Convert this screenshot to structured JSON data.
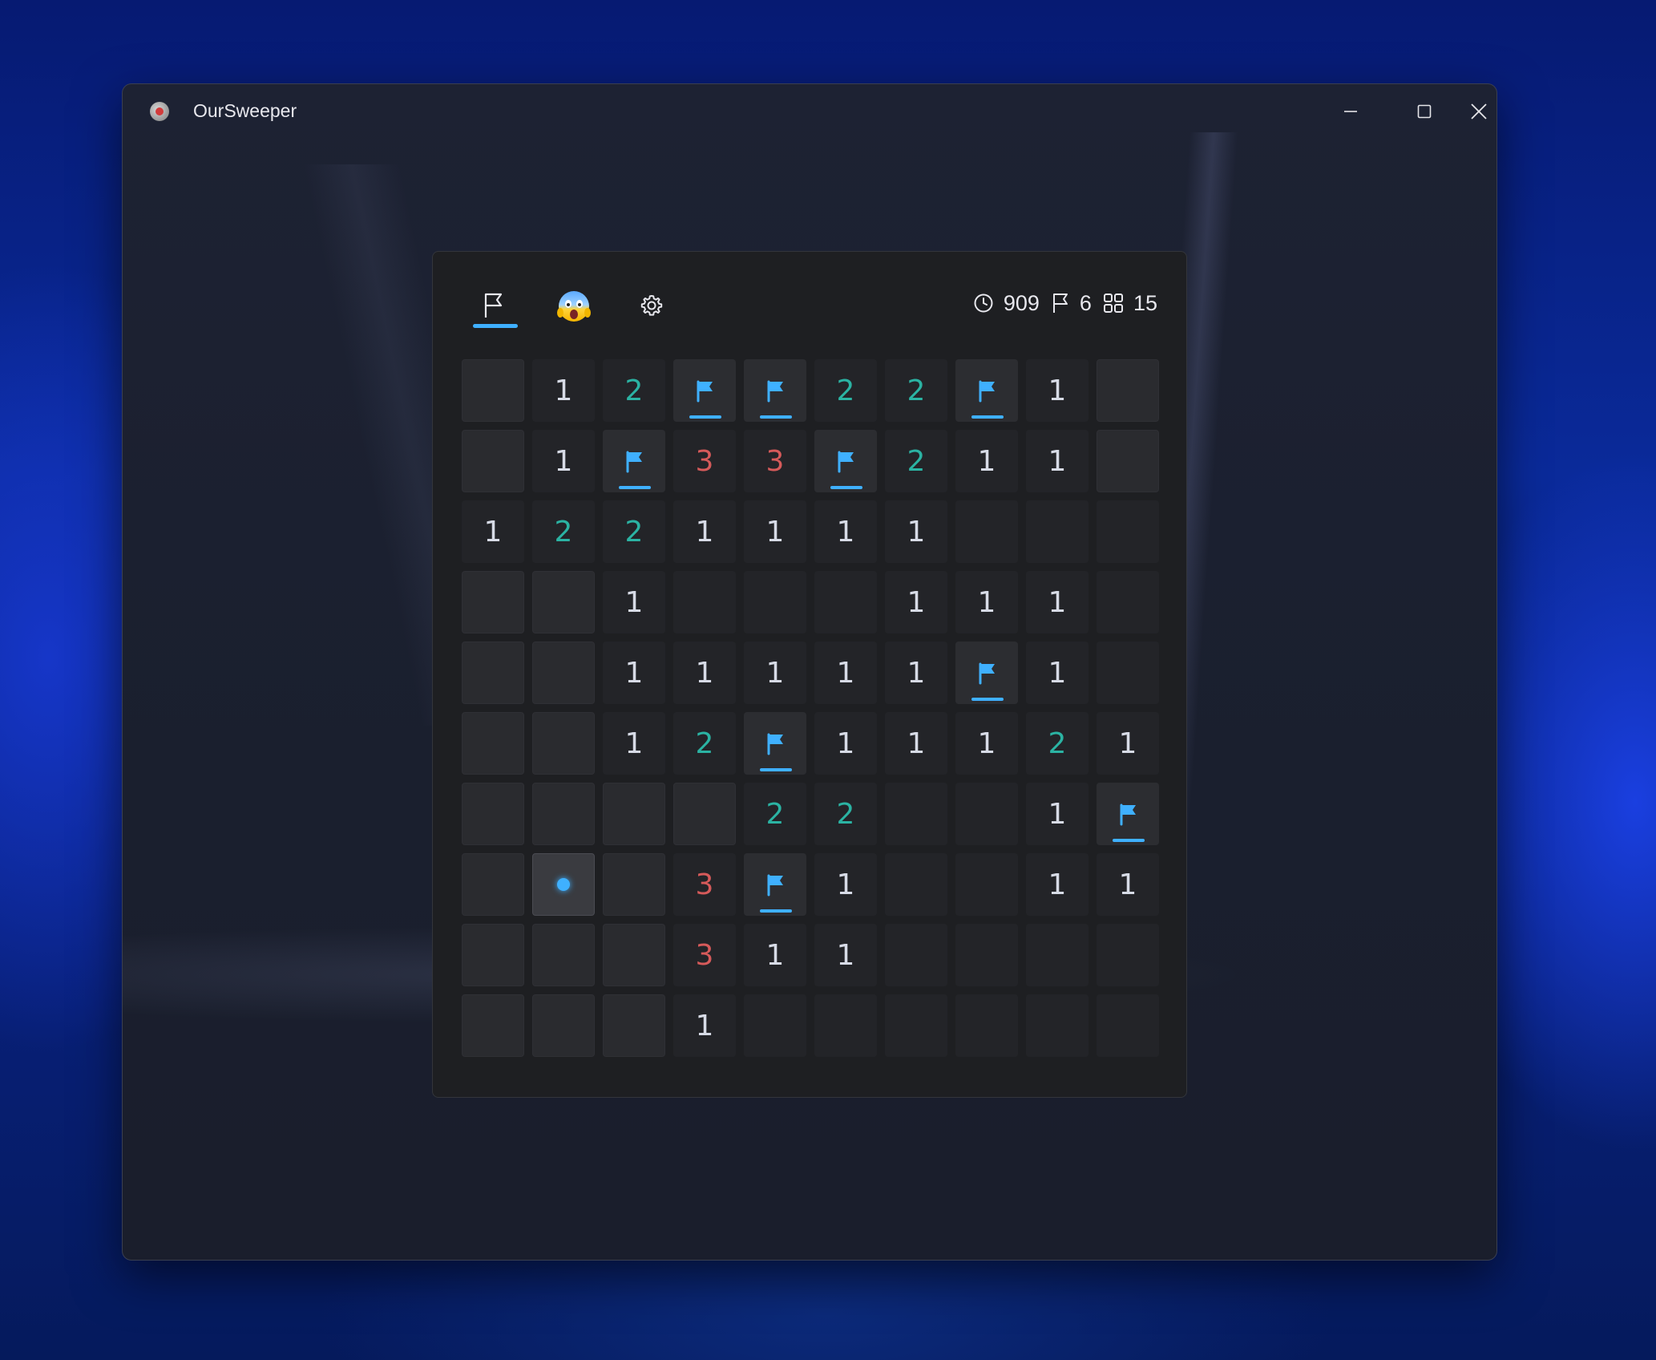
{
  "window": {
    "title": "OurSweeper"
  },
  "toolbar": {
    "flag_tool_icon": "flag-outline-icon",
    "face_icon": "screaming-face-emoji",
    "settings_icon": "gear-icon"
  },
  "stats": {
    "timer": "909",
    "flags": "6",
    "remaining": "15"
  },
  "colors": {
    "accent": "#3fb0ff",
    "number_1": "#d7dbe6",
    "number_2": "#2bb3a3",
    "number_3": "#d65a5a"
  },
  "board": {
    "legend": "H = hidden, F = flag, C = cursor/selected hidden, blank = open empty, digits = adjacent mine count",
    "rows": [
      [
        "H",
        "1",
        "2",
        "F",
        "F",
        "2",
        "2",
        "F",
        "1",
        "H"
      ],
      [
        "H",
        "1",
        "F",
        "3",
        "3",
        "F",
        "2",
        "1",
        "1",
        "H"
      ],
      [
        "1",
        "2",
        "2",
        "1",
        "1",
        "1",
        "1",
        "",
        "",
        ""
      ],
      [
        "H",
        "H",
        "1",
        "",
        "",
        "",
        "1",
        "1",
        "1",
        ""
      ],
      [
        "H",
        "H",
        "1",
        "1",
        "1",
        "1",
        "1",
        "F",
        "1",
        ""
      ],
      [
        "H",
        "H",
        "1",
        "2",
        "F",
        "1",
        "1",
        "1",
        "2",
        "1"
      ],
      [
        "H",
        "H",
        "H",
        "H",
        "2",
        "2",
        "",
        "",
        "1",
        "F"
      ],
      [
        "H",
        "C",
        "H",
        "3",
        "F",
        "1",
        "",
        "",
        "1",
        "1"
      ],
      [
        "H",
        "H",
        "H",
        "3",
        "1",
        "1",
        "",
        "",
        "",
        ""
      ],
      [
        "H",
        "H",
        "H",
        "1",
        "",
        "",
        "",
        "",
        "",
        ""
      ]
    ]
  }
}
